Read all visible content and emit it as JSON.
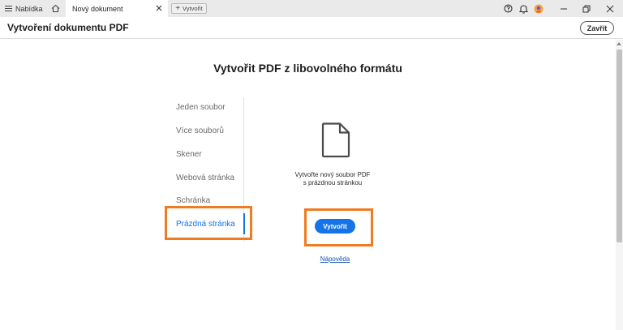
{
  "tabstrip": {
    "menu_label": "Nabídka",
    "document_tab": "Nový dokument",
    "new_tab_label": "Vytvořit",
    "icons": [
      "hamburger-icon",
      "home-icon",
      "close-icon",
      "plus-icon",
      "help-icon",
      "bell-icon",
      "avatar-icon",
      "minimize-icon",
      "restore-icon",
      "window-close-icon"
    ]
  },
  "header": {
    "title": "Vytvoření dokumentu PDF",
    "close_label": "Zavřít"
  },
  "main": {
    "heading": "Vytvořit PDF z libovolného formátu",
    "options": [
      {
        "label": "Jeden soubor",
        "active": false
      },
      {
        "label": "Více souborů",
        "active": false
      },
      {
        "label": "Skener",
        "active": false
      },
      {
        "label": "Webová stránka",
        "active": false
      },
      {
        "label": "Schránka",
        "active": false
      },
      {
        "label": "Prázdná stránka",
        "active": true
      }
    ],
    "description_line1": "Vytvořte nový soubor PDF",
    "description_line2": "s prázdnou stránkou",
    "create_label": "Vytvořit",
    "help_link": "Nápověda"
  },
  "colors": {
    "accent": "#1473e6",
    "highlight": "#f07c22",
    "tabstrip_bg": "#eaeaea"
  }
}
